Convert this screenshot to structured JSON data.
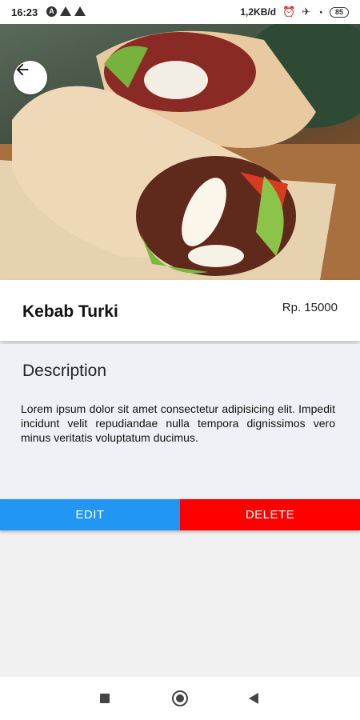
{
  "status_bar": {
    "time": "16:23",
    "speed": "1,2KB/d",
    "battery": "85",
    "left_icons": [
      "a-circle-icon",
      "warning-icon",
      "warning-icon"
    ],
    "right_icons": [
      "alarm-off-icon",
      "airplane-icon",
      "wifi-icon"
    ]
  },
  "product": {
    "name": "Kebab Turki",
    "price": "Rp. 15000"
  },
  "description": {
    "title": "Description",
    "text": "Lorem ipsum dolor sit amet consectetur adipisicing elit. Impedit incidunt velit repudiandae nulla tempora dignissimos vero minus veritatis voluptatum ducimus."
  },
  "actions": {
    "edit_label": "EDIT",
    "delete_label": "DELETE"
  },
  "colors": {
    "edit": "#2196f3",
    "delete": "#ff0000",
    "description_bg": "#eef0f5"
  },
  "nav_bar": {
    "icons": [
      "recent-apps-icon",
      "home-icon",
      "back-icon"
    ]
  }
}
